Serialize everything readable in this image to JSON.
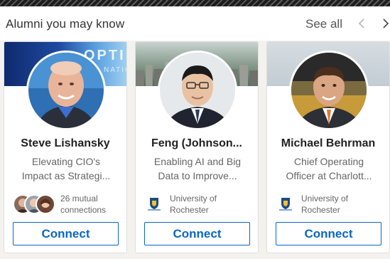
{
  "header": {
    "title": "Alumni you may know",
    "see_all_label": "See all",
    "prev_icon": "chevron-left-icon",
    "next_icon": "chevron-right-icon"
  },
  "colors": {
    "accent": "#0a66c2",
    "text_primary": "#222222",
    "text_secondary": "#666666"
  },
  "cards": [
    {
      "name": "Steve Lishansky",
      "headline_line1": "Elevating CIO's",
      "headline_line2": "Impact as Strategi...",
      "banner_text": "OPTIMI",
      "banner_sub": "NATIO",
      "meta_line1": "26 mutual",
      "meta_line2": "connections",
      "connect_label": "Connect"
    },
    {
      "name": "Feng (Johnson...",
      "headline_line1": "Enabling AI and Big",
      "headline_line2": "Data to Improve...",
      "meta_line1": "University of",
      "meta_line2": "Rochester",
      "connect_label": "Connect"
    },
    {
      "name": "Michael Behrman",
      "headline_line1": "Chief Operating",
      "headline_line2": "Officer at Charlott...",
      "meta_line1": "University of",
      "meta_line2": "Rochester",
      "connect_label": "Connect"
    }
  ]
}
